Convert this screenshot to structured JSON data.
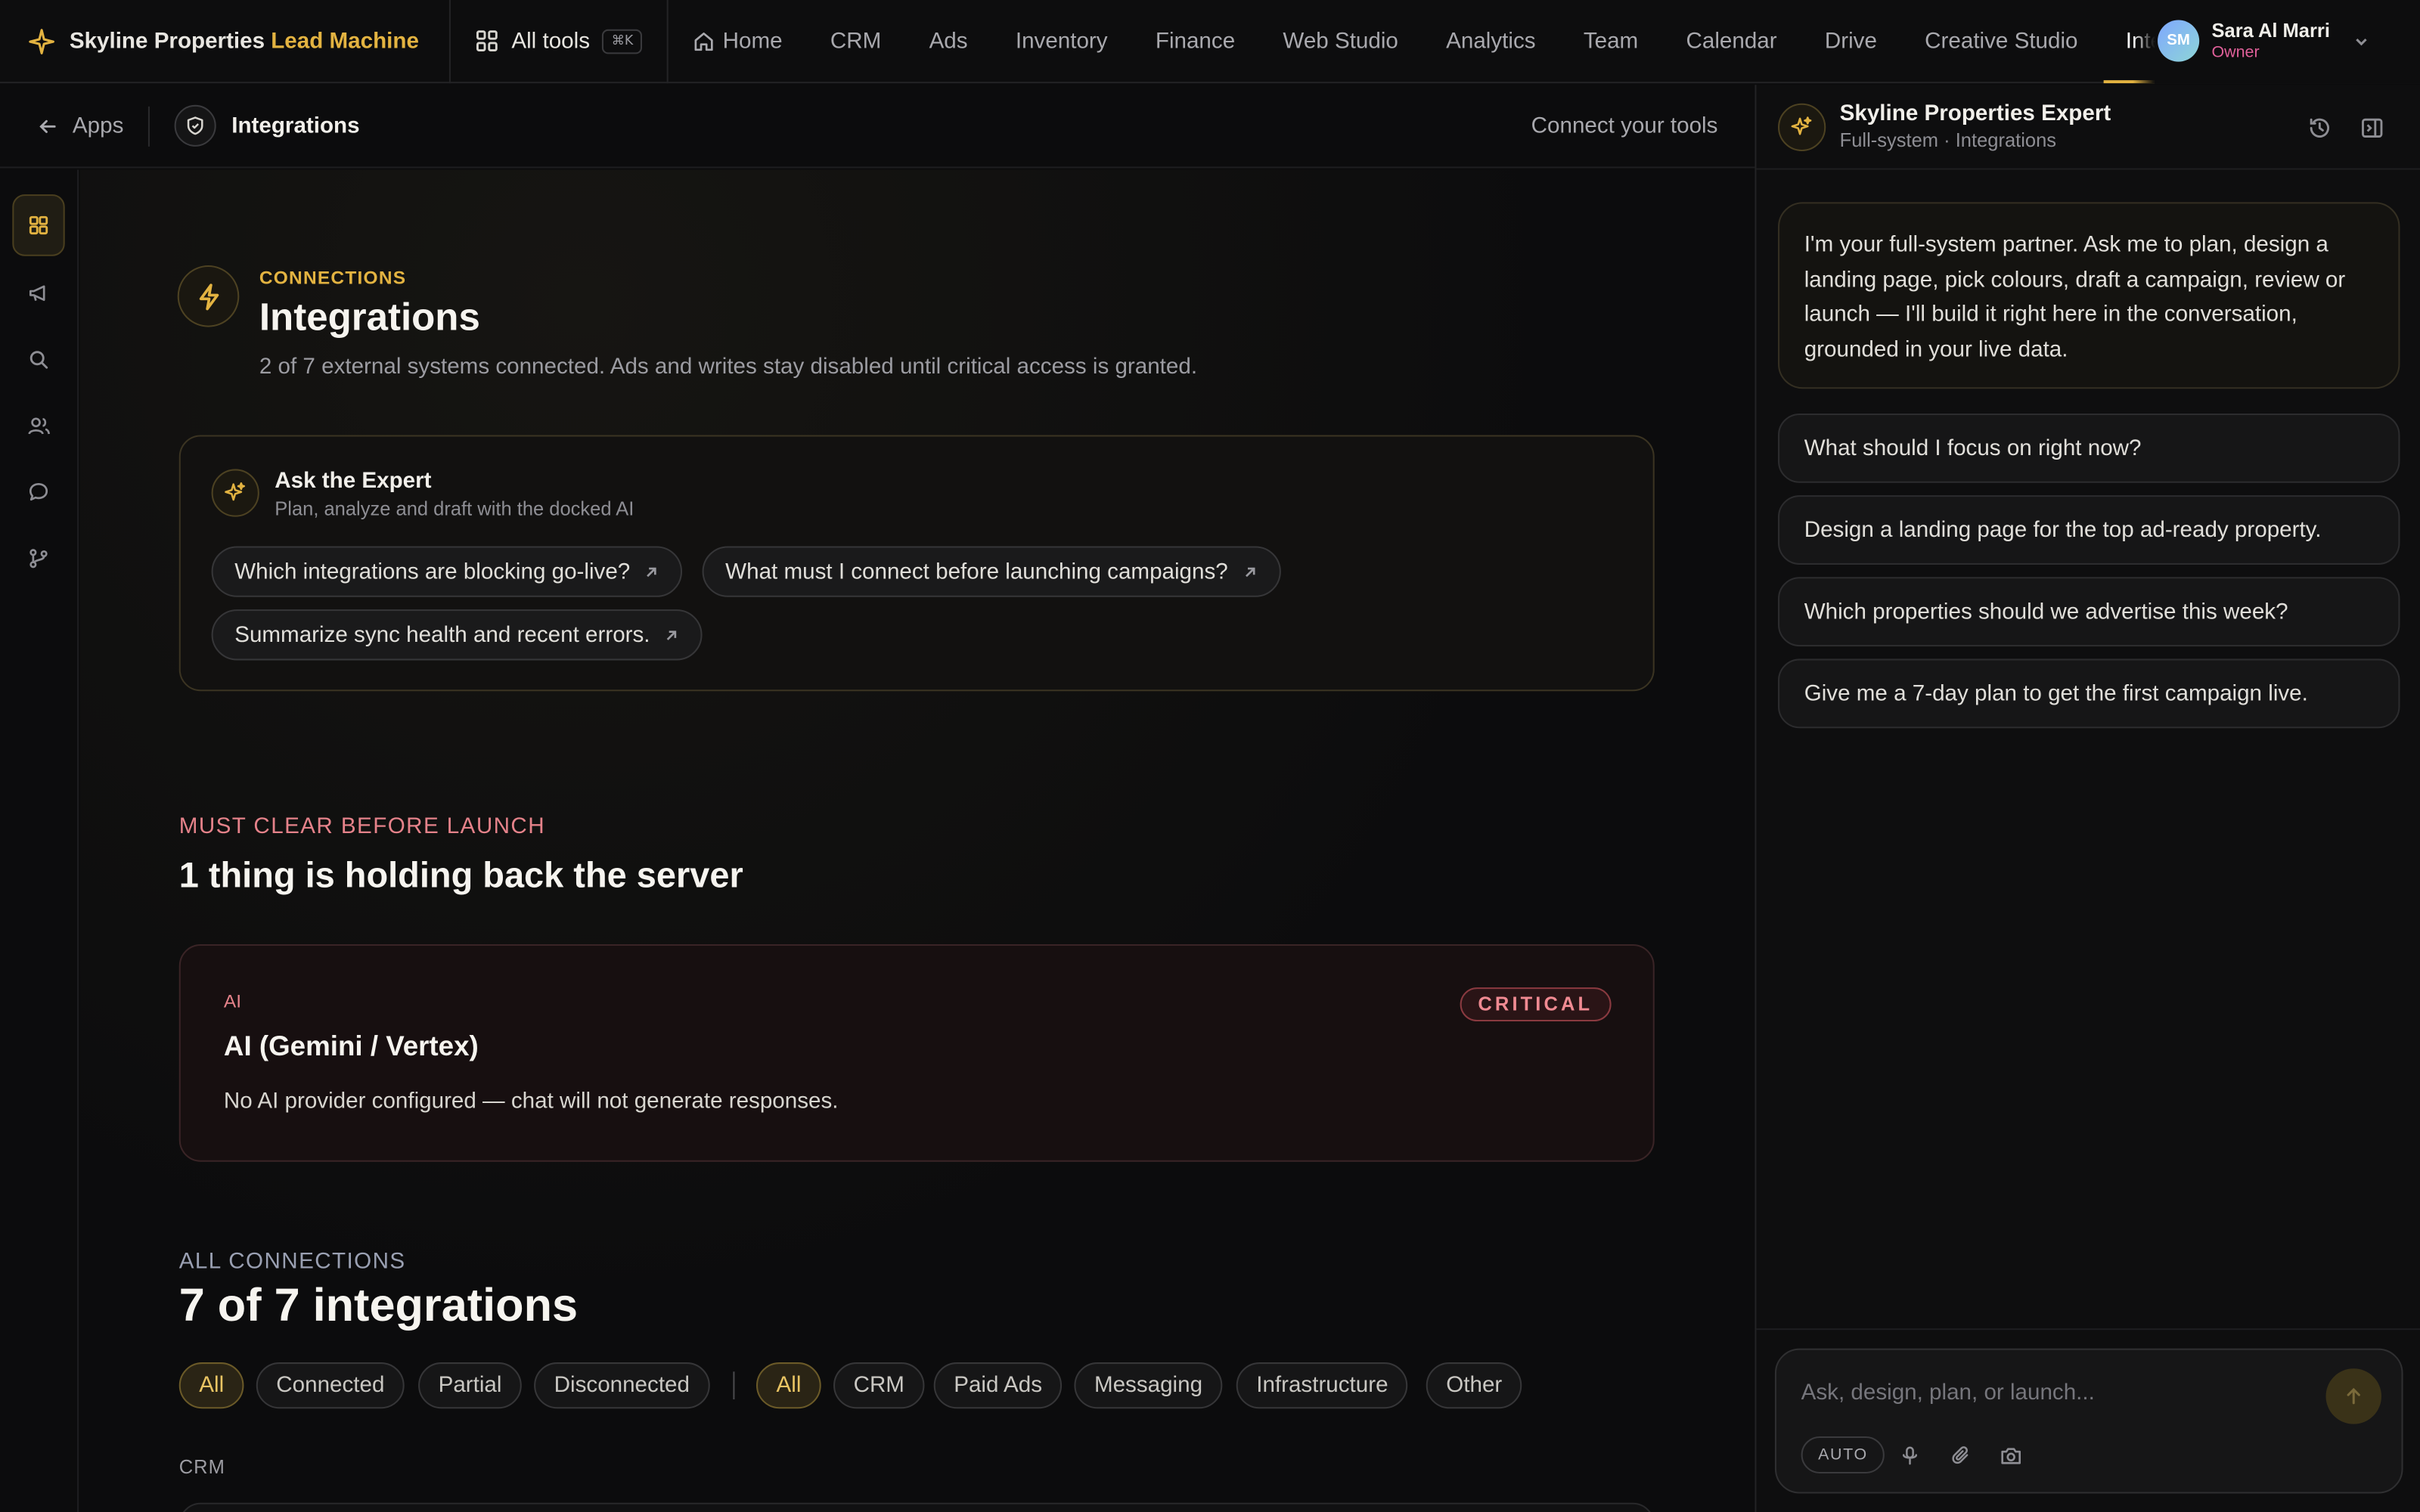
{
  "brand": {
    "name": "Skyline Properties",
    "accent": "Lead Machine"
  },
  "all_tools": {
    "label": "All tools",
    "shortcut": "⌘K"
  },
  "nav": [
    {
      "label": "Home",
      "icon": "home-icon"
    },
    {
      "label": "CRM"
    },
    {
      "label": "Ads"
    },
    {
      "label": "Inventory"
    },
    {
      "label": "Finance"
    },
    {
      "label": "Web Studio"
    },
    {
      "label": "Analytics"
    },
    {
      "label": "Team"
    },
    {
      "label": "Calendar"
    },
    {
      "label": "Drive"
    },
    {
      "label": "Creative Studio"
    },
    {
      "label": "Integ",
      "active": true
    }
  ],
  "user": {
    "initials": "SM",
    "name": "Sara Al Marri",
    "role": "Owner"
  },
  "subheader": {
    "back_label": "Apps",
    "crumb": "Integrations",
    "right_label": "Connect your tools"
  },
  "rail": [
    "dashboard-icon",
    "megaphone-icon",
    "search-icon",
    "users-icon",
    "chat-icon",
    "branch-icon"
  ],
  "hero": {
    "eyebrow": "CONNECTIONS",
    "title": "Integrations",
    "subtitle": "2 of 7 external systems connected. Ads and writes stay disabled until critical access is granted."
  },
  "expert_card": {
    "title": "Ask the Expert",
    "subtitle": "Plan, analyze and draft with the docked AI",
    "prompts": [
      "Which integrations are blocking go-live?",
      "What must I connect before launching campaigns?",
      "Summarize sync health and recent errors."
    ]
  },
  "launch": {
    "eyebrow": "MUST CLEAR BEFORE LAUNCH",
    "title": "1 thing is holding back the server",
    "card": {
      "category": "AI",
      "title": "AI (Gemini / Vertex)",
      "description": "No AI provider configured — chat will not generate responses.",
      "badge": "CRITICAL"
    }
  },
  "all_connections": {
    "eyebrow": "ALL CONNECTIONS",
    "title": "7 of 7 integrations",
    "status_filters": [
      "All",
      "Connected",
      "Partial",
      "Disconnected"
    ],
    "category_filters": [
      "All",
      "CRM",
      "Paid Ads",
      "Messaging",
      "Infrastructure",
      "Other"
    ],
    "section": "CRM"
  },
  "chat": {
    "title": "Skyline Properties Expert",
    "subtitle": "Full-system · Integrations",
    "intro": "I'm your full-system partner. Ask me to plan, design a landing page, pick colours, draft a campaign, review or launch — I'll build it right here in the conversation, grounded in your live data.",
    "suggestions": [
      "What should I focus on right now?",
      "Design a landing page for the top ad-ready property.",
      "Which properties should we advertise this week?",
      "Give me a 7-day plan to get the first campaign live."
    ],
    "input_placeholder": "Ask, design, plan, or launch...",
    "mode": "AUTO"
  },
  "colors": {
    "accent": "#e3b341",
    "critical": "#e5828a",
    "role": "#e0609a"
  }
}
